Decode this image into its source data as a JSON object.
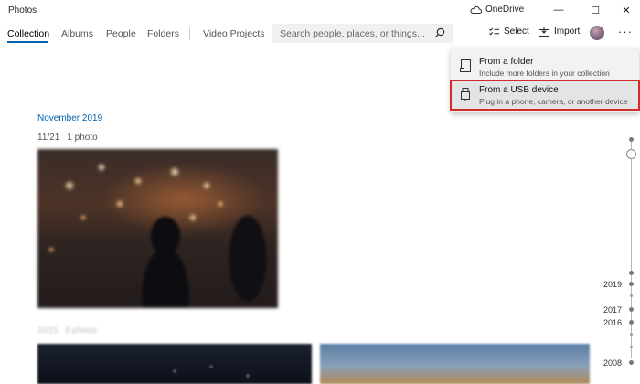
{
  "app": {
    "title": "Photos"
  },
  "titlebar": {
    "onedrive_label": "OneDrive",
    "minimize_glyph": "—",
    "maximize_glyph": "☐",
    "close_glyph": "✕"
  },
  "nav": {
    "tabs": [
      {
        "label": "Collection",
        "active": true
      },
      {
        "label": "Albums",
        "active": false
      },
      {
        "label": "People",
        "active": false
      },
      {
        "label": "Folders",
        "active": false
      },
      {
        "label": "Video Projects",
        "active": false
      }
    ]
  },
  "search": {
    "placeholder": "Search people, places, or things..."
  },
  "toolbar": {
    "select_label": "Select",
    "import_label": "Import",
    "more_glyph": "···"
  },
  "import_menu": {
    "items": [
      {
        "title": "From a folder",
        "subtitle": "Include more folders in your collection",
        "icon": "folder-icon"
      },
      {
        "title": "From a USB device",
        "subtitle": "Plug in a phone, camera, or another device",
        "icon": "usb-icon",
        "highlighted": true
      }
    ]
  },
  "collection": {
    "month_heading": "November 2019",
    "group": {
      "date": "11/21",
      "count": "1 photo"
    },
    "group2": {
      "date": "10/21",
      "count": "8 photos"
    }
  },
  "timeline": {
    "years": [
      "2019",
      "2017",
      "2016",
      "2008"
    ]
  },
  "colors": {
    "accent": "#0063b1",
    "highlight_outline": "#d12b2b"
  }
}
